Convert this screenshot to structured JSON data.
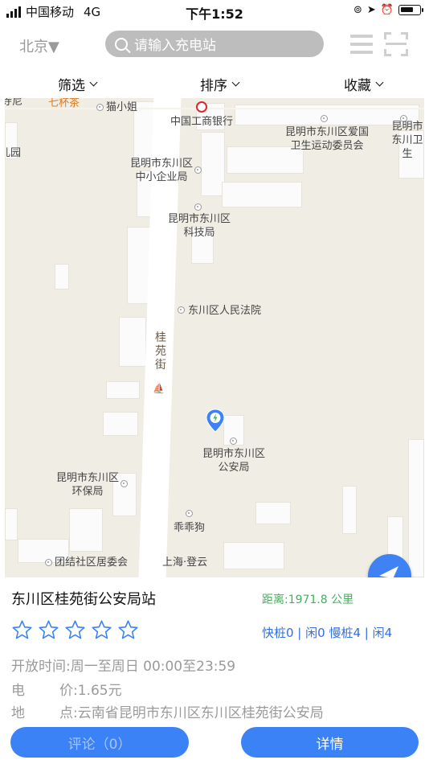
{
  "status_bar": {
    "carrier": "中国移动",
    "network": "4G",
    "time": "下午1:52",
    "battery_level": 0.7
  },
  "nav": {
    "city": "北京▼",
    "search_placeholder": "请输入充电站",
    "menu_icon": "list-icon",
    "scan_icon": "scan-icon"
  },
  "filters": [
    {
      "label": "筛选"
    },
    {
      "label": "排序"
    },
    {
      "label": "收藏"
    }
  ],
  "map": {
    "road_label": "桂苑街",
    "pois": [
      {
        "label": "寺尼"
      },
      {
        "label": "七杯茶"
      },
      {
        "label": "猫小姐"
      },
      {
        "label": "中国工商银行"
      },
      {
        "label": "昆明市东川区爱国卫生运动委员会"
      },
      {
        "label": "昆明市东川卫生"
      },
      {
        "label": "儿园"
      },
      {
        "label": "昆明市东川区中小企业局"
      },
      {
        "label": "昆明市东川区科技局"
      },
      {
        "label": "东川区人民法院"
      },
      {
        "label": "昆明市东川区公安局"
      },
      {
        "label": "昆明市东川区环保局"
      },
      {
        "label": "乖乖狗"
      },
      {
        "label": "团结社区居委会"
      },
      {
        "label": "上海·登云"
      }
    ],
    "colors": {
      "background": "#f0ede5",
      "road": "#ffffff",
      "pin": "#3f82f4"
    }
  },
  "station": {
    "name": "东川区桂苑街公安局站",
    "distance": "距离:1971.8 公里",
    "rating": 0,
    "rating_max": 5,
    "piles": "快桩0 | 闲0  慢桩4 | 闲4",
    "open_hours": "开放时间:周一至周日 00:00至23:59",
    "price_label": "电",
    "price_value": "价:1.65元",
    "address_label": "地",
    "address_value": "点:云南省昆明市东川区东川区桂苑街公安局"
  },
  "buttons": {
    "comment": "评论（0）",
    "detail": "详情"
  },
  "accent_color": "#3b82f6"
}
